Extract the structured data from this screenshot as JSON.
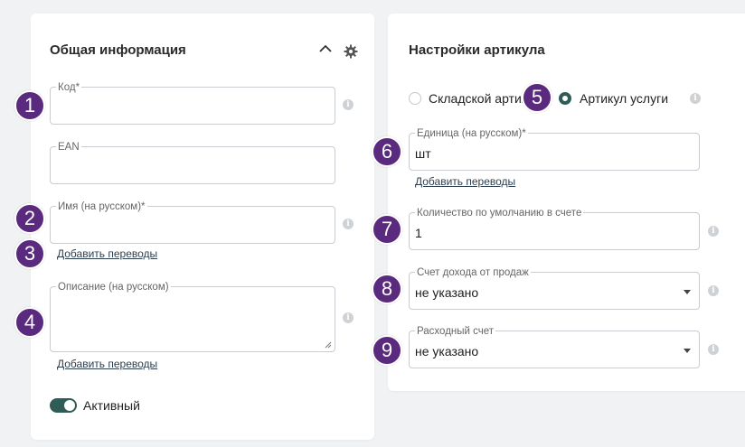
{
  "general": {
    "title": "Общая информация",
    "code_label": "Код",
    "required_mark": "*",
    "ean_label": "EAN",
    "name_label": "Имя (на русском)",
    "add_translations": "Добавить переводы",
    "description_label": "Описание (на русском)",
    "active_label": "Активный",
    "active_on": true
  },
  "article": {
    "title": "Настройки артикула",
    "option_stock": "Складской артикул",
    "option_service": "Артикул услуги",
    "selected_option": "service",
    "unit_label": "Единица (на русском)",
    "unit_value": "шт",
    "add_translations": "Добавить переводы",
    "qty_label": "Количество по умолчанию в счете",
    "qty_value": "1",
    "income_label": "Счет дохода от продаж",
    "income_value": "не указано",
    "expense_label": "Расходный счет",
    "expense_value": "не указано"
  },
  "badges": [
    "1",
    "2",
    "3",
    "4",
    "5",
    "6",
    "7",
    "8",
    "9"
  ],
  "info_glyph": "i",
  "colors": {
    "accent": "#2f5c56",
    "badge": "#5a2a7e"
  }
}
